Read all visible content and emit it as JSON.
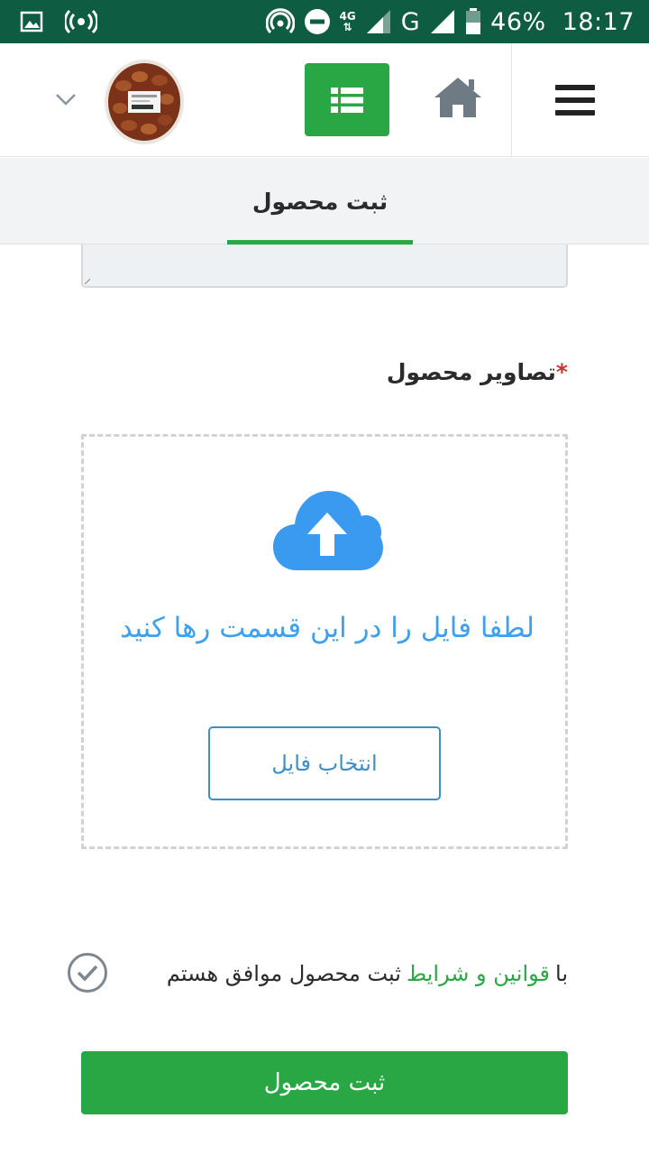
{
  "status_bar": {
    "network_type": "4G",
    "carrier_letter": "G",
    "battery": "46%",
    "time": "18:17",
    "icons": [
      "gallery-icon",
      "hotspot-icon",
      "wifi-tethering-icon",
      "do-not-disturb-icon",
      "signal-icon",
      "battery-icon"
    ]
  },
  "header": {
    "menu_icon": "hamburger-icon",
    "home_icon": "home-icon",
    "list_icon": "list-icon",
    "dropdown_icon": "chevron-down-icon"
  },
  "tabs": [
    {
      "label": "ثبت محصول",
      "active": true
    }
  ],
  "form": {
    "images_label": "تصاویر محصول",
    "required_mark": "*",
    "dropzone_text": "لطفا فایل را در این قسمت رها کنید",
    "choose_file_label": "انتخاب فایل",
    "terms_prefix": "با",
    "terms_link": "قوانین و شرایط",
    "terms_suffix": "ثبت محصول موافق هستم",
    "submit_label": "ثبت محصول"
  },
  "colors": {
    "status_bar": "#0e5c41",
    "accent_green": "#29a745",
    "link_blue": "#3ea0f0",
    "button_border_blue": "#3f8fc4",
    "tab_background": "#f1f3f4"
  }
}
